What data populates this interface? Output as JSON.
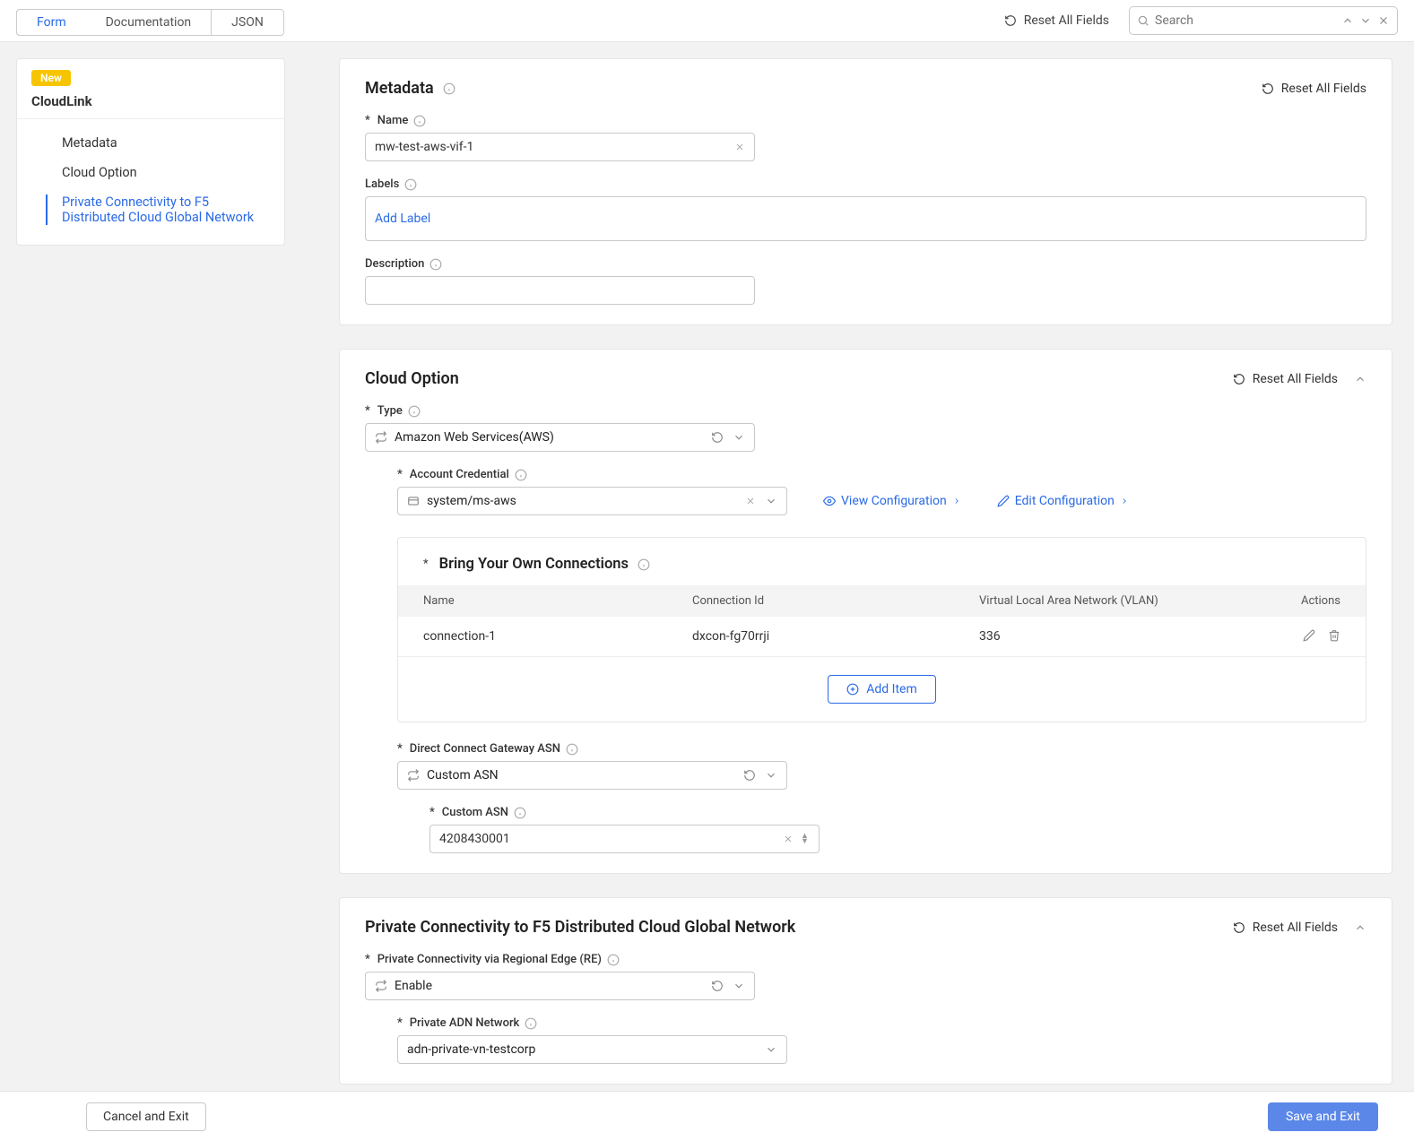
{
  "topbar": {
    "tabs": [
      "Form",
      "Documentation",
      "JSON"
    ],
    "reset": "Reset All Fields",
    "search_placeholder": "Search"
  },
  "sidebar": {
    "badge": "New",
    "title": "CloudLink",
    "items": [
      "Metadata",
      "Cloud Option",
      "Private Connectivity to F5 Distributed Cloud Global Network"
    ]
  },
  "metadata": {
    "title": "Metadata",
    "reset": "Reset All Fields",
    "name_label": "Name",
    "name_value": "mw-test-aws-vif-1",
    "labels_label": "Labels",
    "add_label": "Add Label",
    "desc_label": "Description"
  },
  "cloud": {
    "title": "Cloud Option",
    "reset": "Reset All Fields",
    "type_label": "Type",
    "type_value": "Amazon Web Services(AWS)",
    "acct_label": "Account Credential",
    "acct_value": "system/ms-aws",
    "view_config": "View Configuration",
    "edit_config": "Edit Configuration",
    "byoc_title": "Bring Your Own Connections",
    "table": {
      "cols": [
        "Name",
        "Connection Id",
        "Virtual Local Area Network (VLAN)",
        "Actions"
      ],
      "row": {
        "name": "connection-1",
        "conn": "dxcon-fg70rrji",
        "vlan": "336"
      }
    },
    "add_item": "Add Item",
    "dcg_label": "Direct Connect Gateway ASN",
    "dcg_value": "Custom ASN",
    "asn_label": "Custom ASN",
    "asn_value": "4208430001"
  },
  "priv": {
    "title": "Private Connectivity to F5 Distributed Cloud Global Network",
    "reset": "Reset All Fields",
    "re_label": "Private Connectivity via Regional Edge (RE)",
    "re_value": "Enable",
    "adn_label": "Private ADN Network",
    "adn_value": "adn-private-vn-testcorp"
  },
  "footer": {
    "cancel": "Cancel and Exit",
    "save": "Save and Exit"
  }
}
